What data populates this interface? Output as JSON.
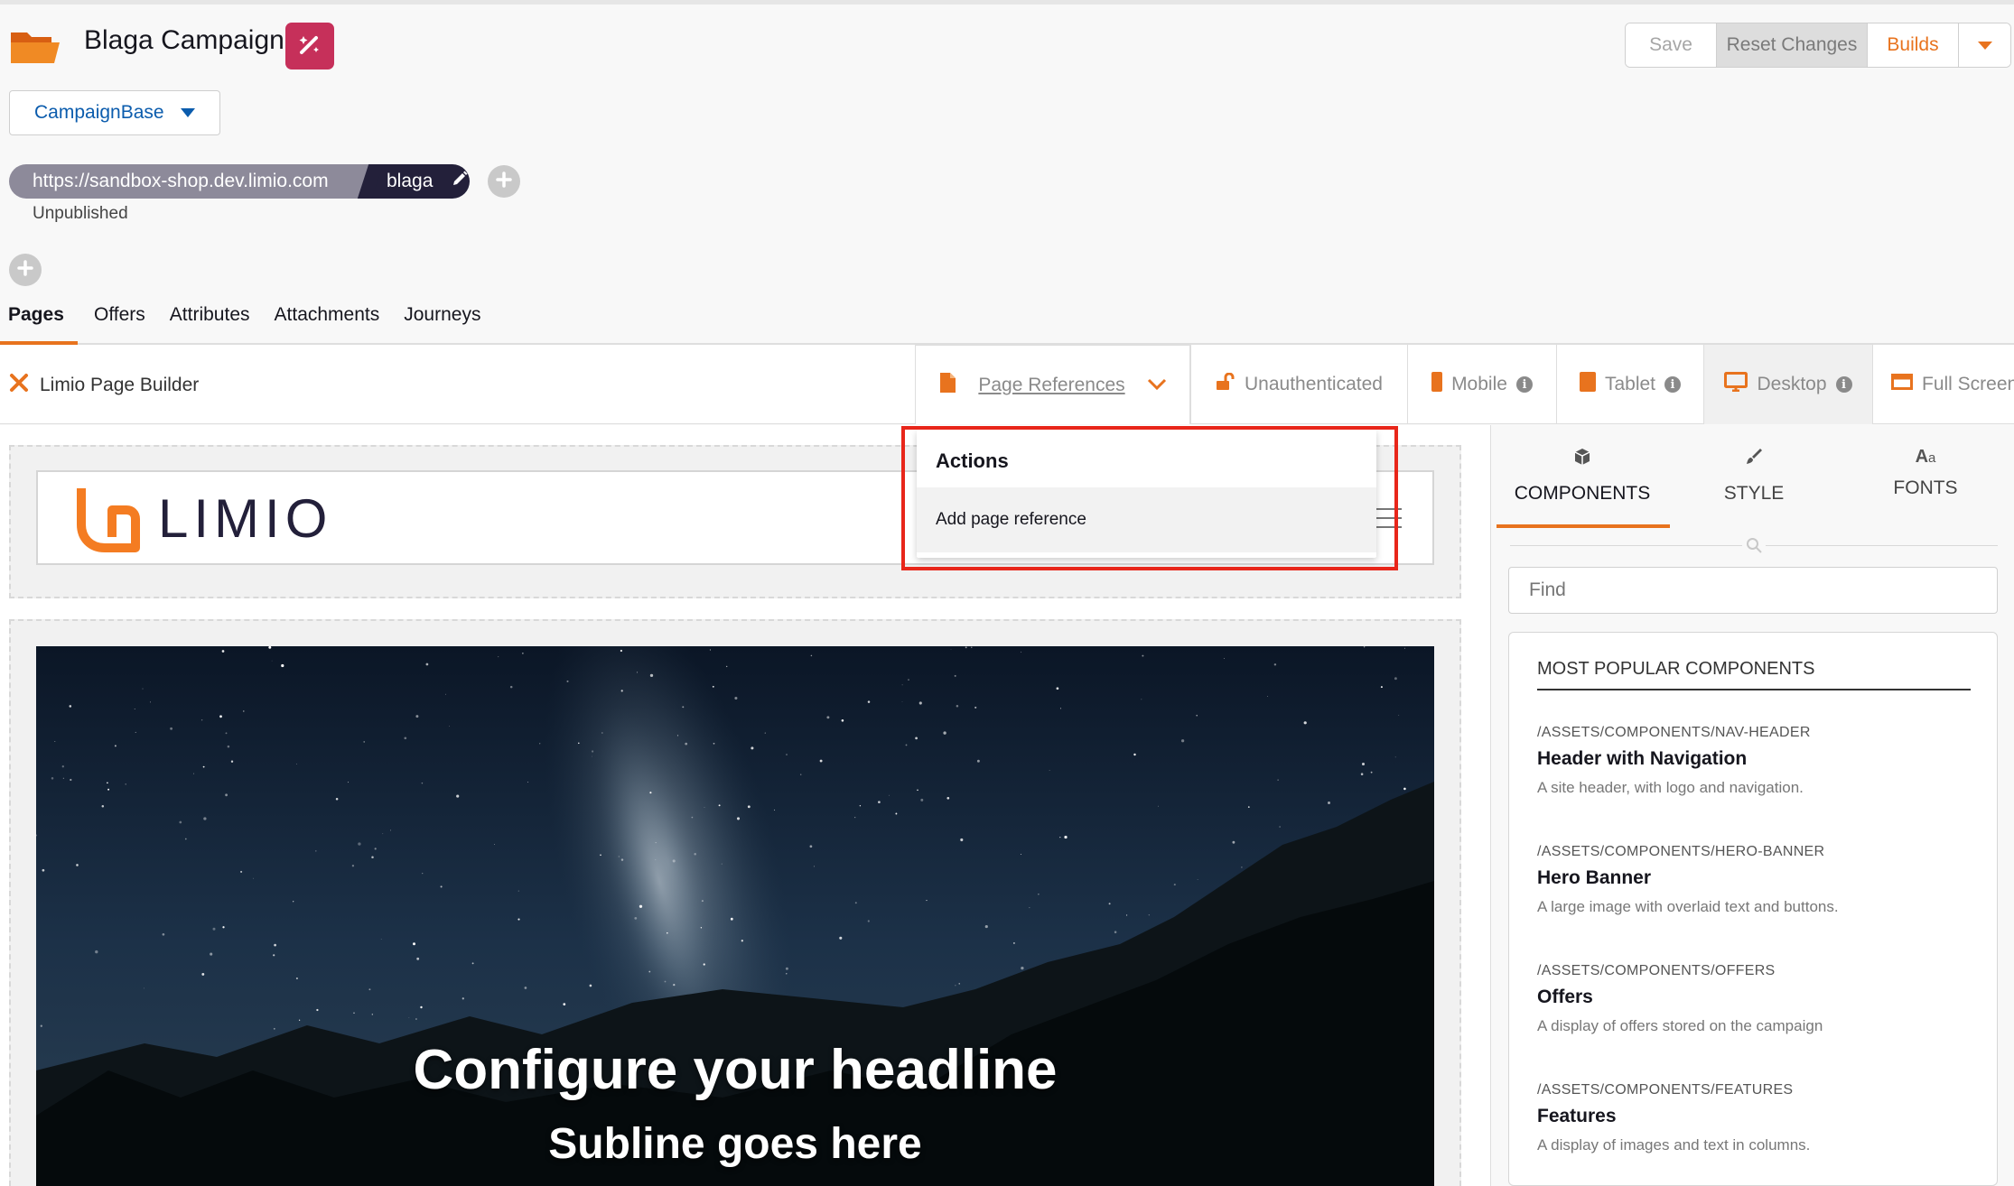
{
  "header": {
    "title": "Blaga Campaign",
    "folder_icon": "folder-icon",
    "magic_icon": "magic-wand-icon",
    "buttons": {
      "save": "Save",
      "reset": "Reset Changes",
      "builds": "Builds"
    }
  },
  "campaign_select": {
    "value": "CampaignBase"
  },
  "url": {
    "host": "https://sandbox-shop.dev.limio.com",
    "slug": "blaga",
    "status": "Unpublished"
  },
  "tabs": [
    {
      "label": "Pages",
      "active": true
    },
    {
      "label": "Offers"
    },
    {
      "label": "Attributes"
    },
    {
      "label": "Attachments"
    },
    {
      "label": "Journeys"
    }
  ],
  "toolbar": {
    "builder_label": "Limio Page Builder",
    "page_references": "Page References",
    "unauthenticated": "Unauthenticated",
    "mobile": "Mobile",
    "tablet": "Tablet",
    "desktop": "Desktop",
    "full_screen": "Full Screen"
  },
  "dropdown": {
    "heading": "Actions",
    "item": "Add page reference"
  },
  "canvas": {
    "logo_text": "LIMIO",
    "hero_headline": "Configure your headline",
    "hero_subline": "Subline goes here"
  },
  "right_panel": {
    "tabs": {
      "components": "COMPONENTS",
      "style": "STYLE",
      "fonts": "FONTS"
    },
    "find_placeholder": "Find",
    "section_title": "MOST POPULAR COMPONENTS",
    "components": [
      {
        "path": "/ASSETS/COMPONENTS/NAV-HEADER",
        "name": "Header with Navigation",
        "desc": "A site header, with logo and navigation."
      },
      {
        "path": "/ASSETS/COMPONENTS/HERO-BANNER",
        "name": "Hero Banner",
        "desc": "A large image with overlaid text and buttons."
      },
      {
        "path": "/ASSETS/COMPONENTS/OFFERS",
        "name": "Offers",
        "desc": "A display of offers stored on the campaign"
      },
      {
        "path": "/ASSETS/COMPONENTS/FEATURES",
        "name": "Features",
        "desc": "A display of images and text in columns."
      }
    ]
  },
  "colors": {
    "accent": "#e8731e",
    "brand_pink": "#c6305a",
    "dark": "#23203a",
    "highlight": "#e8261a"
  }
}
